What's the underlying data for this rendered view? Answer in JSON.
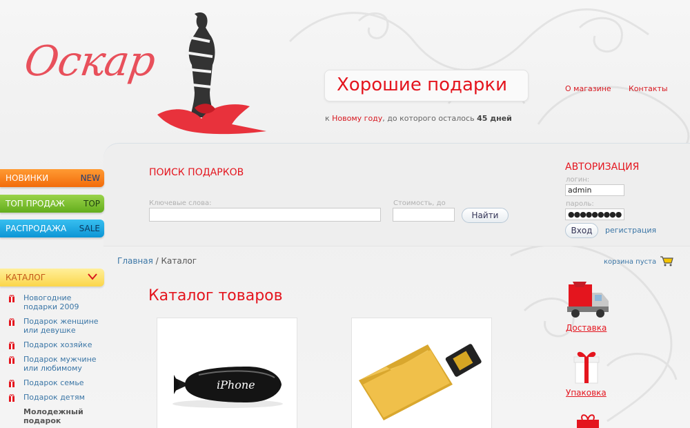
{
  "header": {
    "logo_text": "Оскар",
    "slogan": "Хорошие подарки",
    "countdown": {
      "prefix": "к ",
      "holiday": "Новому году",
      "middle": ", до которого осталось ",
      "days": "45 дней"
    },
    "links": [
      "О магазине",
      "Контакты"
    ]
  },
  "side_tabs": [
    {
      "label": "НОВИНКИ",
      "tag": "NEW"
    },
    {
      "label": "ТОП ПРОДАЖ",
      "tag": "TOP"
    },
    {
      "label": "РАСПРОДАЖА",
      "tag": "SALE"
    }
  ],
  "search": {
    "title": "ПОИСК ПОДАРКОВ",
    "keywords_label": "Ключевые слова:",
    "keywords_value": "",
    "price_label": "Стоимость, до",
    "price_value": "",
    "button": "Найти"
  },
  "auth": {
    "title": "АВТОРИЗАЦИЯ",
    "login_label": "логин:",
    "login_value": "admin",
    "password_label": "пароль:",
    "password_value": "●●●●●●●●●●",
    "login_button": "Вход",
    "register_link": "регистрация"
  },
  "catalog": {
    "header": "КАТАЛОГ",
    "items": [
      {
        "label": "Новогодние подарки 2009"
      },
      {
        "label": "Подарок женщине или девушке"
      },
      {
        "label": "Подарок хозяйке"
      },
      {
        "label": "Подарок мужчине или любимому"
      },
      {
        "label": "Подарок семье"
      },
      {
        "label": "Подарок детям"
      },
      {
        "label": "Молодежный подарок"
      }
    ]
  },
  "breadcrumb": {
    "home": "Главная",
    "separator": " / ",
    "current": "Каталог"
  },
  "cart": {
    "label": "корзина пуста"
  },
  "main": {
    "title": "Каталог товаров",
    "products": [
      {
        "image_text": "iPhone"
      },
      {
        "image_text": ""
      }
    ]
  },
  "services": [
    {
      "label": "Доставка",
      "icon": "delivery-truck-icon"
    },
    {
      "label": "Упаковка",
      "icon": "gift-box-icon"
    }
  ],
  "colors": {
    "accent_red": "#e4151e",
    "link_blue": "#3b76a6"
  }
}
